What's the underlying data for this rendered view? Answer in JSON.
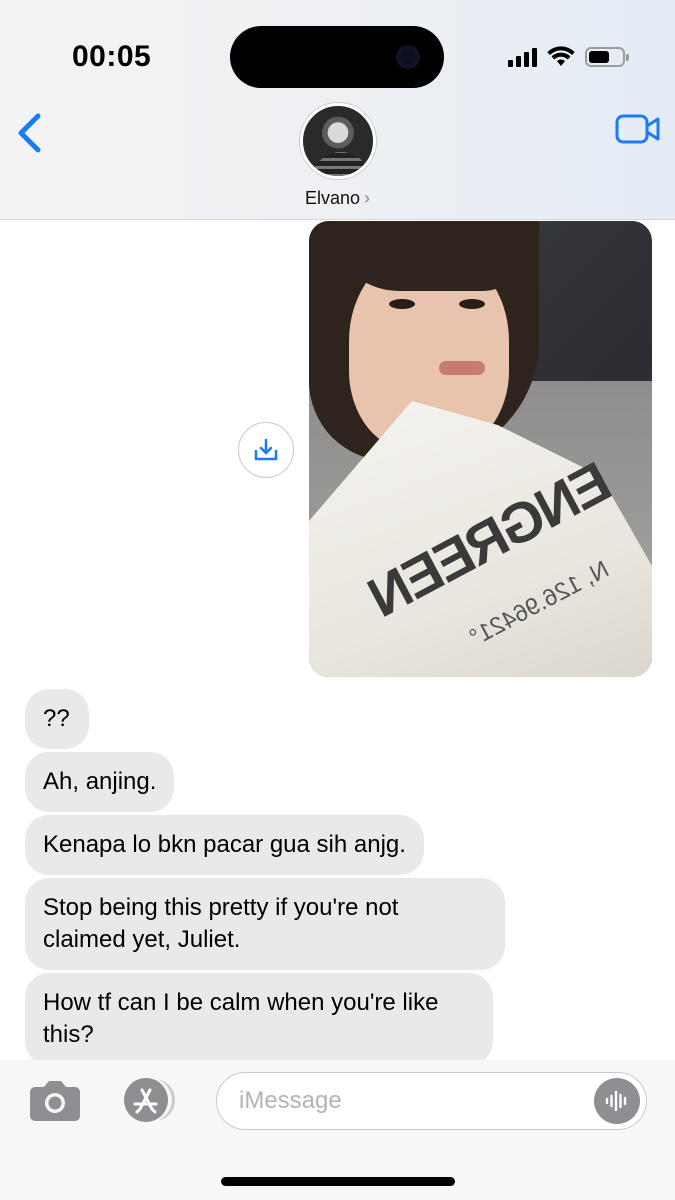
{
  "status_bar": {
    "time": "00:05",
    "icons": [
      "cellular-signal-icon",
      "wifi-icon",
      "battery-icon"
    ],
    "battery_level": 0.62
  },
  "header": {
    "back_icon": "chevron-left-icon",
    "contact_name": "Elvano",
    "contact_chevron": "›",
    "video_icon": "video-camera-icon",
    "accent_color": "#1a7cf5"
  },
  "conversation": {
    "photo_message": {
      "save_icon": "download-tray-icon",
      "shirt_print": "ENGREEN",
      "shirt_print_sub": "N, 126.96421°"
    },
    "received_messages": [
      "??",
      "Ah, anjing.",
      "Kenapa lo bkn pacar gua sih anjg.",
      "Stop being this pretty if you're not claimed yet, Juliet.",
      "How tf can I be calm when you're like this?"
    ],
    "bubble_color": "#e9e9eb"
  },
  "composer": {
    "camera_icon": "camera-icon",
    "apps_icon": "app-store-icon",
    "placeholder": "iMessage",
    "value": "",
    "audio_icon": "waveform-icon"
  }
}
